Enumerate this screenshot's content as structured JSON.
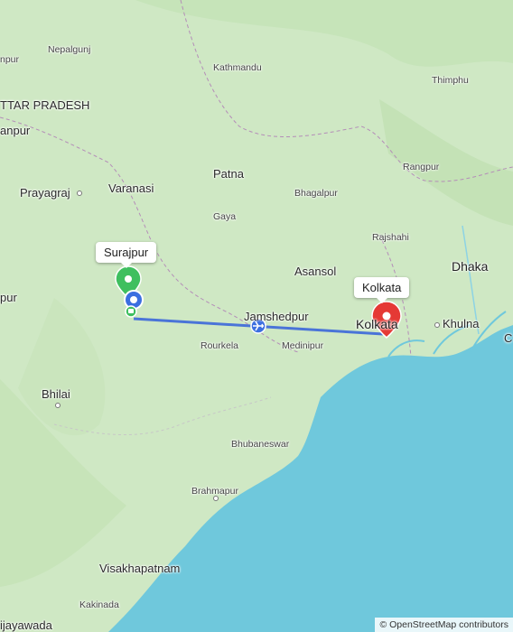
{
  "map": {
    "attribution": "© OpenStreetMap contributors",
    "colors": {
      "land": "#cfe8c4",
      "water": "#6fc8dc",
      "route": "#4a74d8",
      "origin_pin": "#3fbf5f",
      "destination_pin": "#e53935",
      "current_pin": "#3b6fe0"
    },
    "route": {
      "mode": "flight",
      "from": "Surajpur",
      "to": "Kolkata"
    },
    "callouts": {
      "origin": "Surajpur",
      "destination": "Kolkata"
    },
    "places": {
      "nepalgunj": "Nepalgunj",
      "kathmandu": "Kathmandu",
      "thimphu": "Thimphu",
      "uttar_pradesh": "TTAR PRADESH",
      "kanpur": "anpur",
      "pur_top": "npur",
      "patna": "Patna",
      "rangpur": "Rangpur",
      "prayagraj": "Prayagraj",
      "varanasi": "Varanasi",
      "bhagalpur": "Bhagalpur",
      "gaya": "Gaya",
      "rajshahi": "Rajshahi",
      "dhaka": "Dhaka",
      "asansol": "Asansol",
      "jamshedpur": "Jamshedpur",
      "kolkata": "Kolkata",
      "khulna": "Khulna",
      "medinipur": "Medinipur",
      "rourkela": "Rourkela",
      "pur_left": "pur",
      "bhilai": "Bhilai",
      "bhubaneswar": "Bhubaneswar",
      "brahmapur": "Brahmapur",
      "visakhapatnam": "Visakhapatnam",
      "kakinada": "Kakinada",
      "vijayawada": "ijayawada",
      "right_edge": "C"
    }
  }
}
